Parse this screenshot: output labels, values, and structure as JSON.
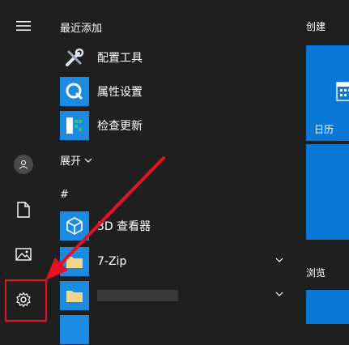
{
  "left_rail": {
    "menu_icon": "hamburger-icon",
    "user_icon": "user-icon",
    "documents_icon": "document-icon",
    "pictures_icon": "picture-icon",
    "settings_icon": "gear-icon"
  },
  "app_list": {
    "recent_title": "最近添加",
    "recent_items": [
      {
        "label": "配置工具",
        "icon": "tools-icon"
      },
      {
        "label": "属性设置",
        "icon": "q-icon"
      },
      {
        "label": "检查更新",
        "icon": "update-icon"
      }
    ],
    "expand_label": "展开",
    "hash_header": "#",
    "items": [
      {
        "label": "3D 查看器",
        "icon": "cube-icon"
      },
      {
        "label": "7-Zip",
        "icon": "folder-icon"
      },
      {
        "label": "",
        "icon": "folder-icon"
      }
    ]
  },
  "tiles": {
    "create_title": "创建",
    "calendar_label": "日历",
    "browse_title": "浏览"
  },
  "colors": {
    "background": "#1f1f1f",
    "tile_blue": "#0a78d7",
    "highlight_red": "#e81123"
  }
}
